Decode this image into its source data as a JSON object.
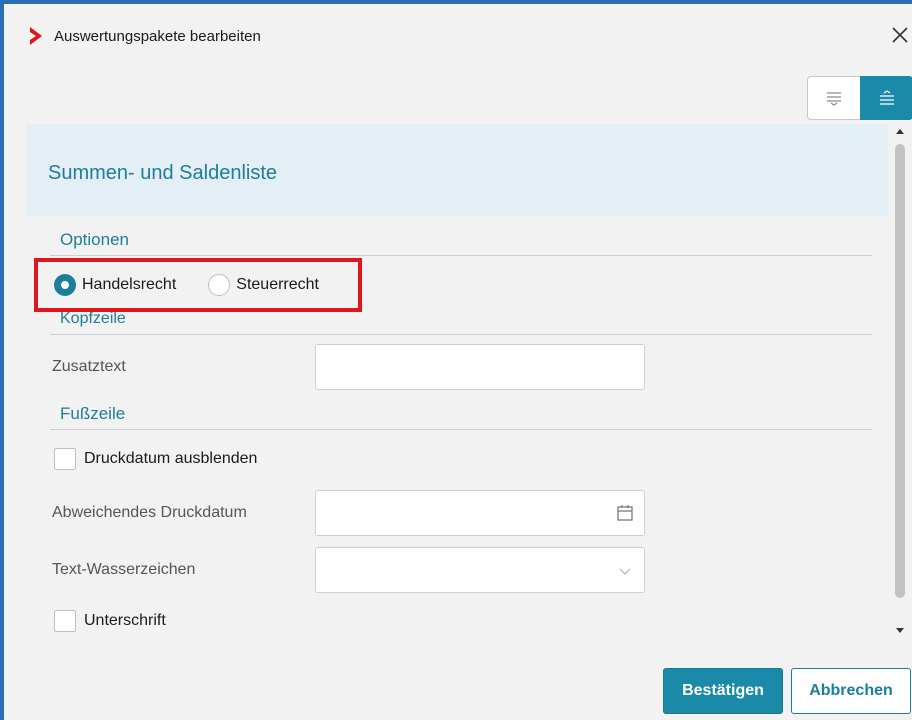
{
  "window": {
    "title": "Auswertungspakete bearbeiten",
    "accent_color": "#1a8aa8",
    "logo_color": "#e0161e"
  },
  "icons": {
    "logo": "chevron-right-icon",
    "close": "close-icon",
    "view_collapse": "collapse-lines-icon",
    "view_expand": "expand-lines-icon",
    "calendar": "calendar-icon",
    "dropdown": "chevron-down-icon"
  },
  "section": {
    "title": "Summen- und Saldenliste"
  },
  "options": {
    "heading": "Optionen",
    "radios": [
      {
        "label": "Handelsrecht",
        "selected": true
      },
      {
        "label": "Steuerrecht",
        "selected": false
      }
    ]
  },
  "header_group": {
    "heading": "Kopfzeile",
    "zusatztext_label": "Zusatztext",
    "zusatztext_value": ""
  },
  "footer_group": {
    "heading": "Fußzeile",
    "hide_print_date_label": "Druckdatum ausblenden",
    "hide_print_date_checked": false,
    "alt_print_date_label": "Abweichendes Druckdatum",
    "alt_print_date_value": "",
    "watermark_label": "Text-Wasserzeichen",
    "watermark_value": "",
    "signature_label": "Unterschrift",
    "signature_checked": false
  },
  "buttons": {
    "confirm": "Bestätigen",
    "cancel": "Abbrechen"
  }
}
